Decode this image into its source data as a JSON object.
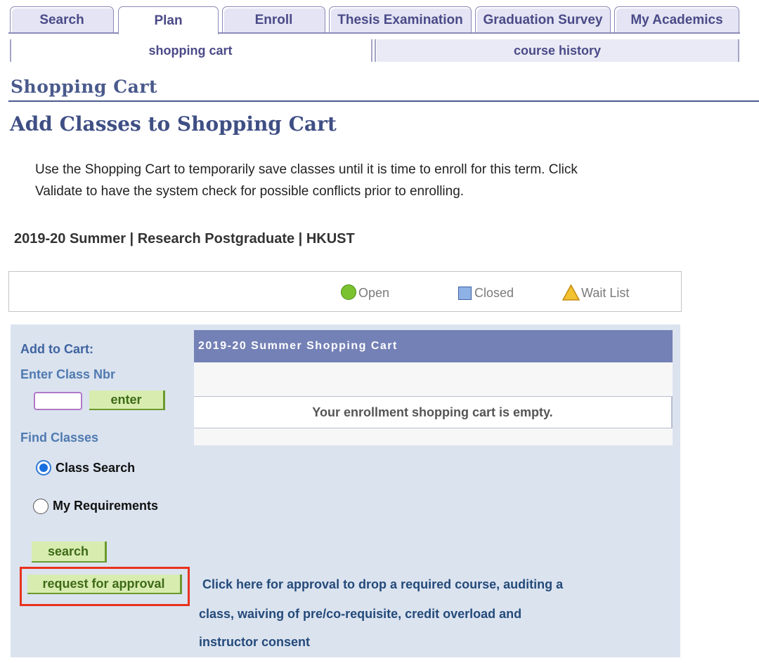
{
  "tabs": [
    {
      "label": "Search"
    },
    {
      "label": "Plan"
    },
    {
      "label": "Enroll"
    },
    {
      "label": "Thesis Examination"
    },
    {
      "label": "Graduation Survey"
    },
    {
      "label": "My Academics"
    }
  ],
  "active_tab": "Plan",
  "subtabs": [
    {
      "label": "shopping cart"
    },
    {
      "label": "course history"
    }
  ],
  "active_subtab": "shopping cart",
  "page": {
    "section_title": "Shopping Cart",
    "heading": "Add Classes to Shopping Cart",
    "instructions_line1": "Use the Shopping Cart to temporarily save classes until it is time to enroll for this term.  Click",
    "instructions_line2": "Validate to have the system check for possible conflicts prior to enrolling.",
    "term_info": "2019-20 Summer | Research Postgraduate | HKUST"
  },
  "legend": {
    "open": "Open",
    "closed": "Closed",
    "wait_list": "Wait List",
    "colors": {
      "open": "#7ac230",
      "closed": "#8fb2e6",
      "wait_list": "#f2c230"
    }
  },
  "add_to_cart": {
    "title": "Add to Cart:",
    "enter_class_label": "Enter Class Nbr",
    "class_nbr_value": "",
    "enter_button": "enter",
    "find_classes_label": "Find Classes",
    "options": [
      {
        "label": "Class Search",
        "selected": true
      },
      {
        "label": "My Requirements",
        "selected": false
      }
    ],
    "search_button": "search",
    "request_button": "request for approval",
    "request_note_line1": "Click here for approval to drop a required course, auditing a",
    "request_note_line2": "class, waiving of pre/co-requisite, credit overload and",
    "request_note_line3": "instructor consent"
  },
  "cart": {
    "title": "2019-20 Summer Shopping Cart",
    "empty_message": "Your enrollment shopping cart is empty."
  },
  "colors": {
    "tab_text": "#4a4a88",
    "heading": "#3f4f84",
    "cart_header_bg": "#7481b6",
    "button_green": "#d8ecb0",
    "highlight_red": "#e8321e",
    "panel_bg": "#dbe3ef"
  }
}
